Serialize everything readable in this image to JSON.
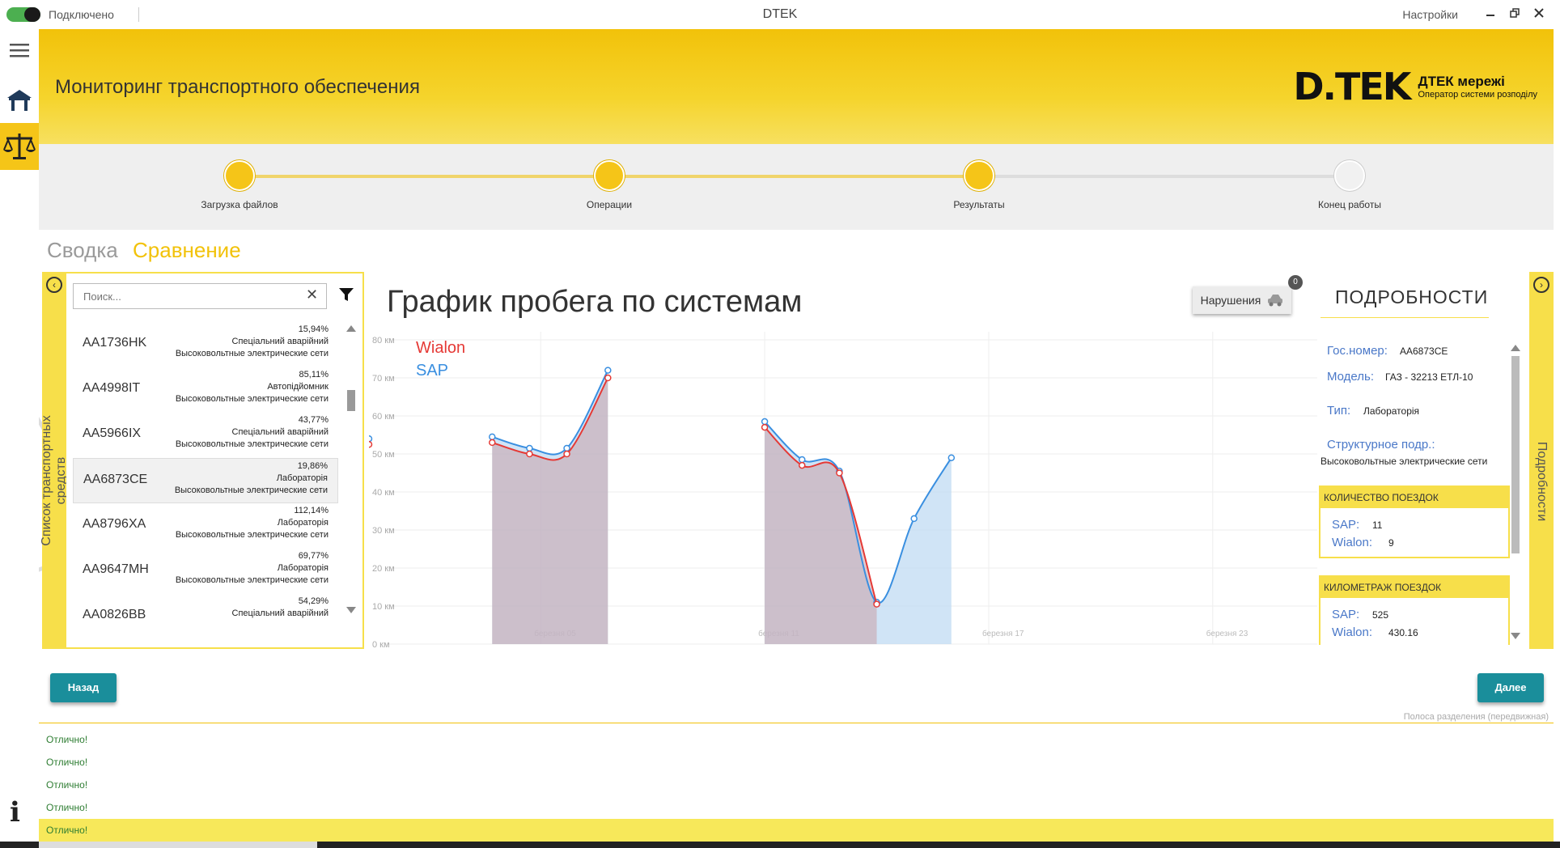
{
  "titlebar": {
    "connection_status": "Подключено",
    "app_title": "DTEK",
    "settings_label": "Настройки",
    "minimize_icon": "minimize-icon",
    "restore_icon": "restore-icon",
    "close_icon": "close-icon"
  },
  "header": {
    "title": "Мониторинг транспортного обеспечения",
    "logo_mark": "D.TEK",
    "logo_line1": "ДТЕК мережі",
    "logo_line2": "Оператор системи розподілу"
  },
  "stepper": {
    "steps": [
      {
        "label": "Загрузка файлов",
        "done": true
      },
      {
        "label": "Операции",
        "done": true
      },
      {
        "label": "Результаты",
        "done": true
      },
      {
        "label": "Конец работы",
        "done": false
      }
    ]
  },
  "tabs": {
    "summary": "Сводка",
    "compare": "Сравнение",
    "active": "compare"
  },
  "vehicle_list": {
    "side_title": "Список транспортных средств",
    "search_placeholder": "Поиск...",
    "items": [
      {
        "plate": "AA1736HK",
        "percent": "15,94%",
        "type": "Спеціальний аварійний",
        "unit": "Высоковольтные электрические сети",
        "selected": false
      },
      {
        "plate": "AA4998IT",
        "percent": "85,11%",
        "type": "Автопідйомник",
        "unit": "Высоковольтные электрические сети",
        "selected": false
      },
      {
        "plate": "AA5966IX",
        "percent": "43,77%",
        "type": "Спеціальний аварійний",
        "unit": "Высоковольтные электрические сети",
        "selected": false
      },
      {
        "plate": "AA6873CE",
        "percent": "19,86%",
        "type": "Лабораторія",
        "unit": "Высоковольтные электрические сети",
        "selected": true
      },
      {
        "plate": "AA8796XA",
        "percent": "112,14%",
        "type": "Лабораторія",
        "unit": "Высоковольтные электрические сети",
        "selected": false
      },
      {
        "plate": "AA9647MH",
        "percent": "69,77%",
        "type": "Лабораторія",
        "unit": "Высоковольтные электрические сети",
        "selected": false
      },
      {
        "plate": "AA0826BB",
        "percent": "54,29%",
        "type": "Спеціальний аварійний",
        "unit": "",
        "selected": false
      }
    ]
  },
  "chart_header": {
    "title": "График пробега по системам",
    "violations_label": "Нарушения",
    "violations_count": "0"
  },
  "chart_data": {
    "type": "line",
    "title": "График пробега по системам",
    "xlabel": "",
    "ylabel": "",
    "ylim": [
      0,
      80
    ],
    "y_ticks": [
      "0 км",
      "10 км",
      "20 км",
      "30 км",
      "40 км",
      "50 км",
      "60 км",
      "70 км",
      "80 км"
    ],
    "x_ticks": [
      "березня 05",
      "березня 11",
      "березня 17",
      "березня 23"
    ],
    "x_tick_days": [
      5,
      11,
      17,
      23
    ],
    "xlim_days": [
      0.4,
      25.8
    ],
    "legend_position": "top-left",
    "grid": true,
    "series": [
      {
        "name": "Wialon",
        "color": "#e53935",
        "segments": [
          [
            {
              "day": 0.4,
              "y": 52.5
            }
          ],
          [
            {
              "day": 3.7,
              "y": 53
            },
            {
              "day": 4.7,
              "y": 50
            },
            {
              "day": 5.7,
              "y": 50
            },
            {
              "day": 6.8,
              "y": 70
            }
          ],
          [
            {
              "day": 11.0,
              "y": 57
            },
            {
              "day": 12.0,
              "y": 47
            },
            {
              "day": 13.0,
              "y": 45
            },
            {
              "day": 14.0,
              "y": 10.5
            }
          ]
        ]
      },
      {
        "name": "SAP",
        "color": "#3a8fe0",
        "segments": [
          [
            {
              "day": 0.4,
              "y": 54
            }
          ],
          [
            {
              "day": 3.7,
              "y": 54.5
            },
            {
              "day": 4.7,
              "y": 51.5
            },
            {
              "day": 5.7,
              "y": 51.5
            },
            {
              "day": 6.8,
              "y": 72
            }
          ],
          [
            {
              "day": 11.0,
              "y": 58.5
            },
            {
              "day": 12.0,
              "y": 48.5
            },
            {
              "day": 13.0,
              "y": 45.5
            },
            {
              "day": 14.0,
              "y": 11
            },
            {
              "day": 15.0,
              "y": 33
            },
            {
              "day": 16.0,
              "y": 49
            }
          ]
        ]
      }
    ]
  },
  "details": {
    "side_title": "Подробности",
    "title": "ПОДРОБНОСТИ",
    "plate_label": "Гос.номер:",
    "plate_value": "AA6873CE",
    "model_label": "Модель:",
    "model_value": "ГАЗ - 32213 ЕТЛ-10",
    "type_label": "Тип:",
    "type_value": "Лабораторія",
    "unit_label": "Структурное подр.:",
    "unit_value": "Высоковольтные электрические сети",
    "trips_count_header": "КОЛИЧЕСТВО ПОЕЗДОК",
    "trips_sap_label": "SAP:",
    "trips_sap_value": "11",
    "trips_wialon_label": "Wialon:",
    "trips_wialon_value": "9",
    "mileage_header": "КИЛОМЕТРАЖ ПОЕЗДОК",
    "mileage_sap_label": "SAP:",
    "mileage_sap_value": "525",
    "mileage_wialon_label": "Wialon:",
    "mileage_wialon_value": "430.16"
  },
  "nav": {
    "back_label": "Назад",
    "next_label": "Далее"
  },
  "log": {
    "divider_label": "Полоса разделения (передвижная)",
    "rows": [
      "Отлично!",
      "Отлично!",
      "Отлично!",
      "Отлично!",
      "Отлично!"
    ]
  },
  "colors": {
    "accent_yellow": "#f5c518",
    "teal_button": "#1a8e9b",
    "wialon": "#e53935",
    "sap": "#3a8fe0",
    "success_text": "#2e7d32"
  }
}
